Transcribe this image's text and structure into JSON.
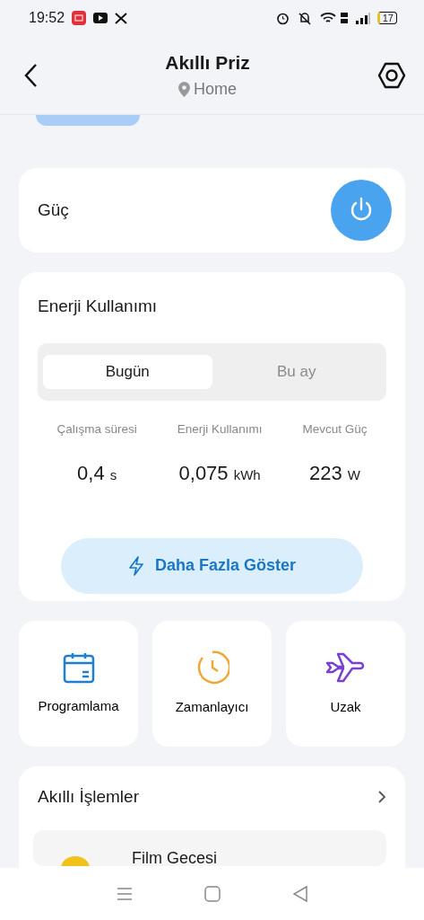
{
  "status_bar": {
    "time": "19:52",
    "battery": "17"
  },
  "header": {
    "title": "Akıllı Priz",
    "location": "Home"
  },
  "power": {
    "label": "Güç",
    "on": true
  },
  "energy": {
    "title": "Enerji Kullanımı",
    "tabs": [
      {
        "label": "Bugün",
        "selected": true
      },
      {
        "label": "Bu ay",
        "selected": false
      }
    ],
    "stats": [
      {
        "label": "Çalışma süresi",
        "value": "0,4",
        "unit": "s"
      },
      {
        "label": "Enerji Kullanımı",
        "value": "0,075",
        "unit": "kWh"
      },
      {
        "label": "Mevcut Güç",
        "value": "223",
        "unit": "W"
      }
    ],
    "more_button": "Daha Fazla Göster"
  },
  "tiles": [
    {
      "kind": "calendar",
      "label": "Programlama"
    },
    {
      "kind": "timer",
      "label": "Zamanlayıcı"
    },
    {
      "kind": "plane",
      "label": "Uzak"
    }
  ],
  "smart_actions": {
    "title": "Akıllı İşlemler",
    "items": [
      {
        "label": "Film Gecesi"
      }
    ]
  }
}
